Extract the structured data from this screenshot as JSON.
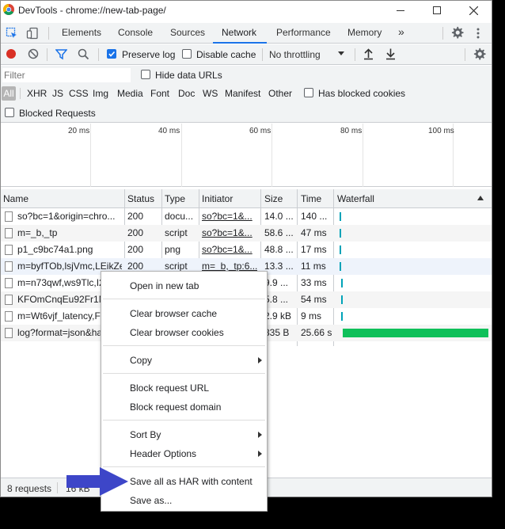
{
  "window": {
    "title": "DevTools - chrome://new-tab-page/"
  },
  "tabs": [
    "Elements",
    "Console",
    "Sources",
    "Network",
    "Performance",
    "Memory"
  ],
  "toolbar": {
    "preserve_log": "Preserve log",
    "disable_cache": "Disable cache",
    "throttling": "No throttling"
  },
  "filter": {
    "placeholder": "Filter",
    "hide_data_urls": "Hide data URLs",
    "types": [
      "All",
      "XHR",
      "JS",
      "CSS",
      "Img",
      "Media",
      "Font",
      "Doc",
      "WS",
      "Manifest",
      "Other"
    ],
    "has_blocked_cookies": "Has blocked cookies",
    "blocked_requests": "Blocked Requests"
  },
  "overview": {
    "ticks": [
      "20 ms",
      "40 ms",
      "60 ms",
      "80 ms",
      "100 ms"
    ]
  },
  "table": {
    "headers": [
      "Name",
      "Status",
      "Type",
      "Initiator",
      "Size",
      "Time",
      "Waterfall"
    ],
    "rows": [
      {
        "name": "so?bc=1&origin=chro...",
        "status": "200",
        "type": "docu...",
        "initiator": "so?bc=1&...",
        "size": "14.0 ...",
        "time": "140 ...",
        "wf_start": 0.02,
        "wf_width": 0.01
      },
      {
        "name": "m=_b,_tp",
        "status": "200",
        "type": "script",
        "initiator": "so?bc=1&...",
        "size": "58.6 ...",
        "time": "47 ms",
        "wf_start": 0.02,
        "wf_width": 0.01
      },
      {
        "name": "p1_c9bc74a1.png",
        "status": "200",
        "type": "png",
        "initiator": "so?bc=1&...",
        "size": "48.8 ...",
        "time": "17 ms",
        "wf_start": 0.02,
        "wf_width": 0.01
      },
      {
        "name": "m=byfTOb,lsjVmc,LEikZe",
        "status": "200",
        "type": "script",
        "initiator": "m=_b,_tp:6...",
        "size": "13.3 ...",
        "time": "11 ms",
        "wf_start": 0.02,
        "wf_width": 0.01
      },
      {
        "name": "m=n73qwf,ws9Tlc,I2",
        "status": "",
        "type": "",
        "initiator": "",
        "size": "9.9 ...",
        "time": "33 ms",
        "wf_start": 0.03,
        "wf_width": 0.01
      },
      {
        "name": "KFOmCnqEu92Fr1M",
        "status": "",
        "type": "",
        "initiator": "",
        "size": "5.8 ...",
        "time": "54 ms",
        "wf_start": 0.03,
        "wf_width": 0.01
      },
      {
        "name": "m=Wt6vjf_latency,F",
        "status": "",
        "type": "",
        "initiator": "",
        "size": "2.9 kB",
        "time": "9 ms",
        "wf_start": 0.03,
        "wf_width": 0.01
      },
      {
        "name": "log?format=json&ha",
        "status": "",
        "type": "",
        "initiator": "",
        "size": "835 B",
        "time": "25.66 s",
        "wf_start": 0.04,
        "wf_width": 0.96
      }
    ]
  },
  "statusbar": {
    "requests": "8 requests",
    "transferred": "16 kB"
  },
  "context_menu": {
    "items": [
      {
        "label": "Open in new tab",
        "submenu": false
      },
      {
        "label": "Clear browser cache",
        "submenu": false
      },
      {
        "label": "Clear browser cookies",
        "submenu": false
      },
      {
        "label": "Copy",
        "submenu": true
      },
      {
        "label": "Block request URL",
        "submenu": false
      },
      {
        "label": "Block request domain",
        "submenu": false
      },
      {
        "label": "Sort By",
        "submenu": true
      },
      {
        "label": "Header Options",
        "submenu": true
      },
      {
        "label": "Save all as HAR with content",
        "submenu": false
      },
      {
        "label": "Save as...",
        "submenu": false
      }
    ]
  },
  "colors": {
    "accent": "#1a73e8",
    "waterfall_short": "#00a3b8",
    "waterfall_long": "#0fc05a",
    "record": "#d93025",
    "pointer_arrow": "#3d46c8"
  }
}
